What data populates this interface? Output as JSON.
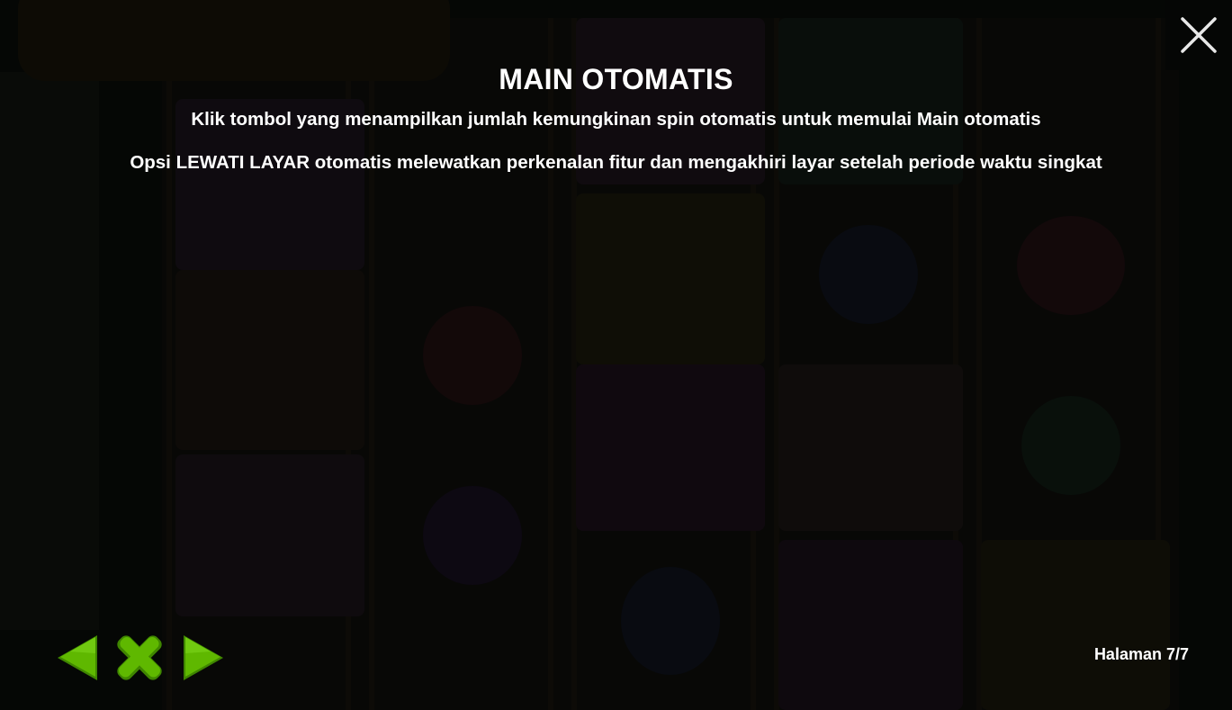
{
  "dialog": {
    "title": "MAIN OTOMATIS",
    "paragraphs": [
      "Klik tombol yang menampilkan jumlah kemungkinan spin otomatis untuk memulai Main otomatis",
      "Opsi LEWATI LAYAR otomatis melewatkan perkenalan fitur dan mengakhiri layar setelah periode waktu singkat"
    ]
  },
  "controls": {
    "close_icon": "close-icon",
    "prev_icon": "arrow-left-icon",
    "home_icon": "x-home-icon",
    "next_icon": "arrow-right-icon"
  },
  "footer": {
    "page_label": "Halaman 7/7"
  },
  "colors": {
    "text": "#ffffff",
    "nav_green": "#5fb800",
    "nav_green_dark": "#3f8600",
    "close_bg": "#050605"
  }
}
